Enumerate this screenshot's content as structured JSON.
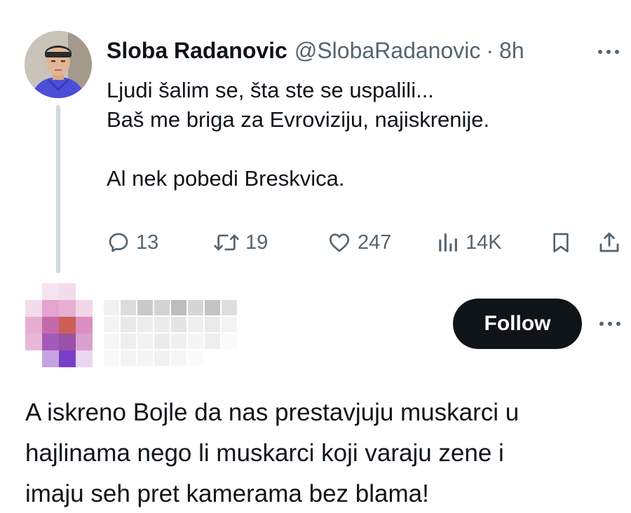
{
  "tweet": {
    "display_name": "Sloba Radanovic",
    "handle": "@SlobaRadanovic",
    "separator": "·",
    "time": "8h",
    "text_lines": [
      "Ljudi šalim se, šta ste se uspalili...",
      "Baš me briga za Evroviziju, najiskrenije.",
      "",
      "Al nek pobedi Breskvica."
    ],
    "actions": {
      "replies": "13",
      "retweets": "19",
      "likes": "247",
      "views": "14K"
    },
    "icons": {
      "more": "more-horizontal-icon",
      "reply": "reply-bubble-icon",
      "retweet": "retweet-icon",
      "like": "heart-icon",
      "views": "views-bar-chart-icon",
      "bookmark": "bookmark-icon",
      "share": "share-upload-icon"
    }
  },
  "reply": {
    "follow_label": "Follow",
    "text_lines": [
      "A iskreno Bojle da nas prestavjuju muskarci u",
      "hajlinama nego li muskarci koji varaju zene i",
      "imaju seh pret kamerama bez blama!"
    ]
  },
  "colors": {
    "text_primary": "#0f1419",
    "text_secondary": "#536471",
    "thread_line": "#cfd9de",
    "follow_button": "#0f1419"
  }
}
